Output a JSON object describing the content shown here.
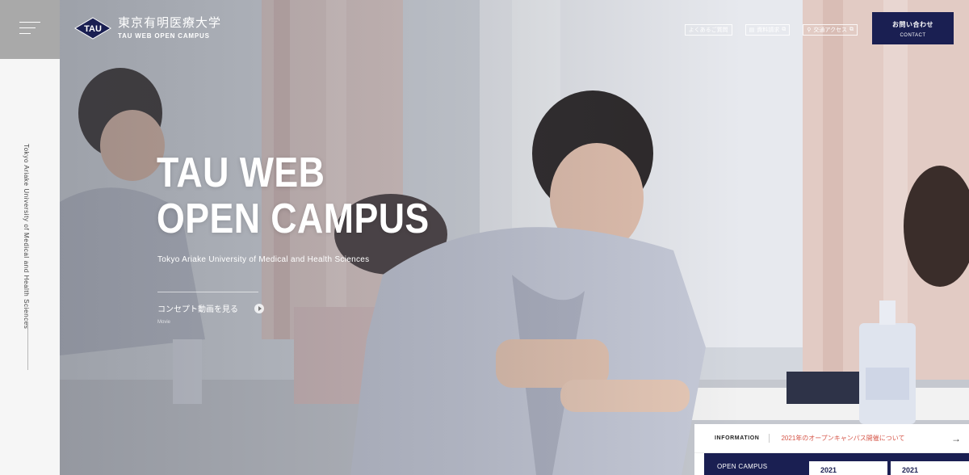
{
  "sidebar": {
    "menu_label": "",
    "vertical_text": "Tokyo Ariake University of Medical and Health Sciences"
  },
  "header": {
    "logo_mark": "TAU",
    "logo_jp": "東京有明医療大学",
    "logo_en": "TAU WEB OPEN CAMPUS",
    "links": [
      {
        "label": "よくあるご質問",
        "icon": "none"
      },
      {
        "label": "資料請求",
        "icon": "document-icon"
      },
      {
        "label": "交通アクセス",
        "icon": "map-pin-icon"
      }
    ],
    "contact_jp": "お問い合わせ",
    "contact_en": "CONTACT"
  },
  "hero": {
    "title_line1": "TAU WEB",
    "title_line2": "OPEN CAMPUS",
    "subtitle": "Tokyo Ariake University of Medical and Health Sciences",
    "movie_label": "コンセプト動画を見る",
    "movie_caption": "Movie"
  },
  "info": {
    "label": "INFORMATION",
    "news": "2021年のオープンキャンパス開催について",
    "open_campus": "OPEN CAMPUS",
    "years": [
      "2021",
      "2021"
    ]
  },
  "colors": {
    "navy": "#1a1f52",
    "accent_red": "#d6574a",
    "rail": "#f6f6f6"
  }
}
